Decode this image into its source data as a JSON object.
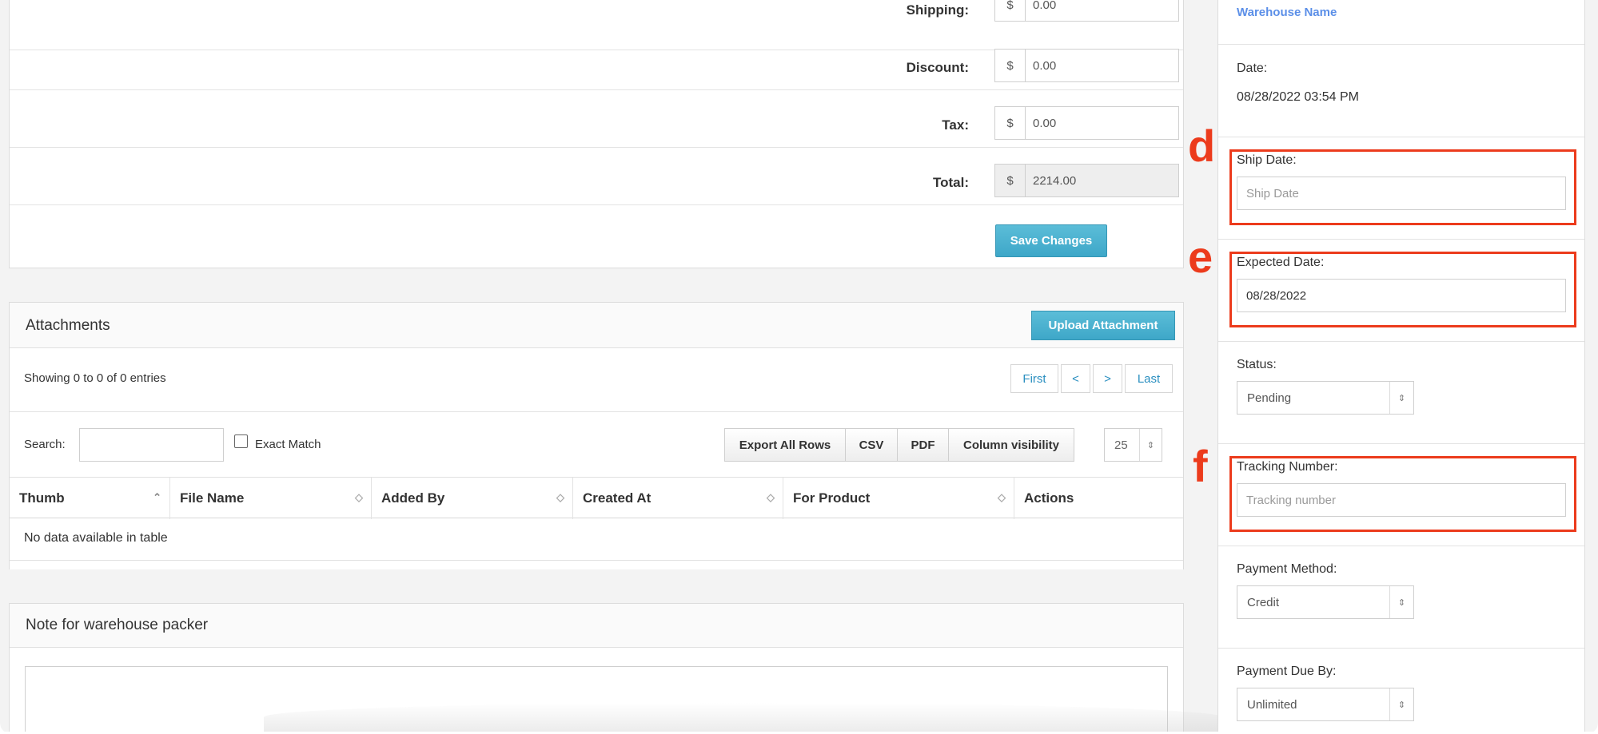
{
  "totals": {
    "rows": [
      {
        "label": "Shipping:",
        "value": "0.00",
        "readonly": false
      },
      {
        "label": "Discount:",
        "value": "0.00",
        "readonly": false
      },
      {
        "label": "Tax:",
        "value": "0.00",
        "readonly": false
      },
      {
        "label": "Total:",
        "value": "2214.00",
        "readonly": true
      }
    ],
    "currency_symbol": "$",
    "save_label": "Save Changes"
  },
  "attachments": {
    "title": "Attachments",
    "upload_label": "Upload Attachment",
    "showing_text": "Showing 0 to 0 of 0 entries",
    "pager": [
      "First",
      "<",
      ">",
      "Last"
    ],
    "search_label": "Search:",
    "search_value": "",
    "exact_match_label": "Exact Match",
    "exact_match_checked": false,
    "export_buttons": [
      "Export All Rows",
      "CSV",
      "PDF",
      "Column visibility"
    ],
    "page_size": "25",
    "columns": [
      "Thumb",
      "File Name",
      "Added By",
      "Created At",
      "For Product",
      "Actions"
    ],
    "empty_text": "No data available in table"
  },
  "note": {
    "title": "Note for warehouse packer",
    "value": ""
  },
  "sidebar": {
    "warehouse_name": "Warehouse Name",
    "date_label": "Date:",
    "date_value": "08/28/2022 03:54 PM",
    "ship_date_label": "Ship Date:",
    "ship_date_placeholder": "Ship Date",
    "expected_date_label": "Expected Date:",
    "expected_date_value": "08/28/2022",
    "status_label": "Status:",
    "status_value": "Pending",
    "tracking_label": "Tracking Number:",
    "tracking_placeholder": "Tracking number",
    "payment_method_label": "Payment Method:",
    "payment_method_value": "Credit",
    "payment_due_label": "Payment Due By:",
    "payment_due_value": "Unlimited"
  },
  "annotations": {
    "letters": [
      "d",
      "e",
      "f"
    ],
    "color": "#ec3b1c"
  },
  "colors": {
    "accent_button": "#3ea7c8",
    "link_blue": "#5b8fe8",
    "pager_text": "#2a8fc0"
  }
}
